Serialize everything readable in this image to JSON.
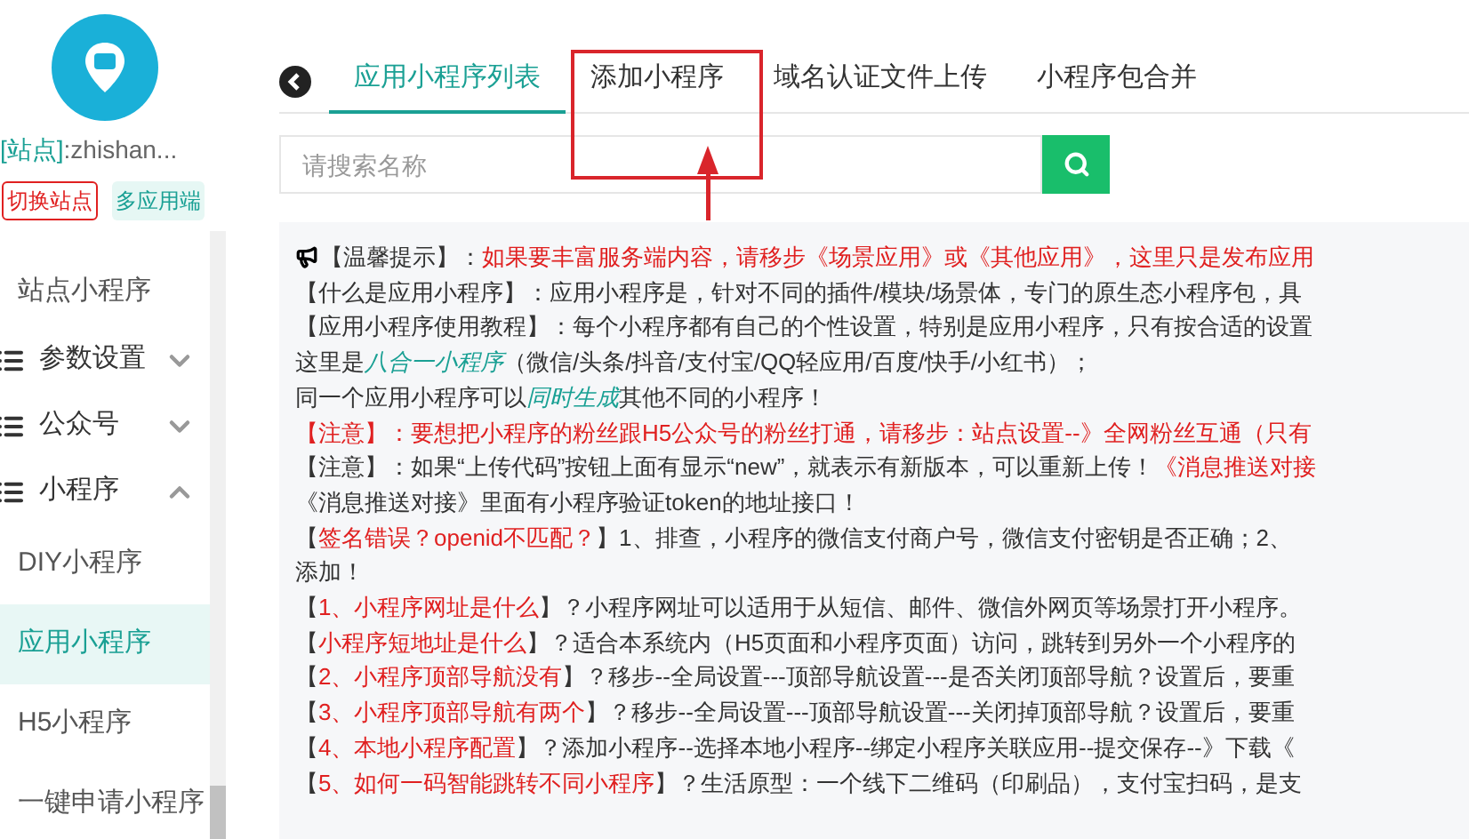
{
  "sidebar": {
    "site_label": "[站点]",
    "site_name": ":zhishan...",
    "buttons": [
      {
        "label": "切换站点",
        "kind": "outline"
      },
      {
        "label": "多应用端",
        "kind": "soft"
      }
    ],
    "menu": [
      {
        "label": "站点小程序",
        "kind": "link",
        "selected": false
      },
      {
        "label": "参数设置",
        "kind": "group",
        "expanded": false
      },
      {
        "label": "公众号",
        "kind": "group",
        "expanded": false
      },
      {
        "label": "小程序",
        "kind": "group",
        "expanded": true,
        "children": [
          {
            "label": "DIY小程序",
            "selected": false
          },
          {
            "label": "应用小程序",
            "selected": true
          },
          {
            "label": "H5小程序",
            "selected": false
          },
          {
            "label": "一键申请小程序",
            "selected": false
          }
        ]
      }
    ]
  },
  "tabs": [
    {
      "label": "应用小程序列表",
      "selected": true
    },
    {
      "label": "添加小程序",
      "selected": false
    },
    {
      "label": "域名认证文件上传",
      "selected": false
    },
    {
      "label": "小程序包合并",
      "selected": false
    }
  ],
  "search": {
    "placeholder": "请搜索名称"
  },
  "notice": [
    [
      {
        "kind": "plain",
        "text": "【温馨提示】："
      },
      {
        "kind": "red",
        "text": "如果要丰富服务端内容，请移步《场景应用》或《其他应用》，这里只是发布应用"
      }
    ],
    [
      {
        "kind": "plain",
        "text": "【什么是应用小程序】：应用小程序是，针对不同的插件/模块/场景体，专门的原生态小程序包，具"
      }
    ],
    [
      {
        "kind": "plain",
        "text": "【应用小程序使用教程】：每个小程序都有自己的个性设置，特别是应用小程序，只有按合适的设置"
      }
    ],
    [
      {
        "kind": "plain",
        "text": "这里是"
      },
      {
        "kind": "green",
        "text": "八合一小程序"
      },
      {
        "kind": "plain",
        "text": "（微信/头条/抖音/支付宝/QQ轻应用/百度/快手/小红书）；"
      }
    ],
    [
      {
        "kind": "plain",
        "text": "同一个应用小程序可以"
      },
      {
        "kind": "green",
        "text": "同时生成"
      },
      {
        "kind": "plain",
        "text": "其他不同的小程序！"
      }
    ],
    [
      {
        "kind": "red",
        "text": "【注意】：要想把小程序的粉丝跟H5公众号的粉丝打通，请移步：站点设置--》全网粉丝互通（只有"
      }
    ],
    [
      {
        "kind": "plain",
        "text": "【注意】：如果“上传代码”按钮上面有显示“new”，就表示有新版本，可以重新上传！"
      },
      {
        "kind": "red",
        "text": "《消息推送对接"
      }
    ],
    [
      {
        "kind": "plain",
        "text": "《消息推送对接》里面有小程序验证token的地址接口！"
      }
    ],
    [
      {
        "kind": "plain",
        "text": "【"
      },
      {
        "kind": "red",
        "text": "签名错误？openid不匹配？"
      },
      {
        "kind": "plain",
        "text": "】1、排查，小程序的微信支付商户号，微信支付密钥是否正确；2、"
      }
    ],
    [
      {
        "kind": "plain",
        "text": "添加！"
      }
    ],
    [
      {
        "kind": "plain",
        "text": "【"
      },
      {
        "kind": "red",
        "text": "1、小程序网址是什么"
      },
      {
        "kind": "plain",
        "text": "】？小程序网址可以适用于从短信、邮件、微信外网页等场景打开小程序。"
      }
    ],
    [
      {
        "kind": "plain",
        "text": "【"
      },
      {
        "kind": "red",
        "text": "小程序短地址是什么"
      },
      {
        "kind": "plain",
        "text": "】？适合本系统内（H5页面和小程序页面）访问，跳转到另外一个小程序的"
      }
    ],
    [
      {
        "kind": "plain",
        "text": "【"
      },
      {
        "kind": "red",
        "text": "2、小程序顶部导航没有"
      },
      {
        "kind": "plain",
        "text": "】？移步--全局设置---顶部导航设置---是否关闭顶部导航？设置后，要重"
      }
    ],
    [
      {
        "kind": "plain",
        "text": "【"
      },
      {
        "kind": "red",
        "text": "3、小程序顶部导航有两个"
      },
      {
        "kind": "plain",
        "text": "】？移步--全局设置---顶部导航设置---关闭掉顶部导航？设置后，要重"
      }
    ],
    [
      {
        "kind": "plain",
        "text": "【"
      },
      {
        "kind": "red",
        "text": "4、本地小程序配置"
      },
      {
        "kind": "plain",
        "text": "】？添加小程序--选择本地小程序--绑定小程序关联应用--提交保存--》下载《"
      }
    ],
    [
      {
        "kind": "plain",
        "text": "【"
      },
      {
        "kind": "red",
        "text": "5、如何一码智能跳转不同小程序"
      },
      {
        "kind": "plain",
        "text": "】？生活原型：一个线下二维码（印刷品），支付宝扫码，是支"
      }
    ]
  ]
}
